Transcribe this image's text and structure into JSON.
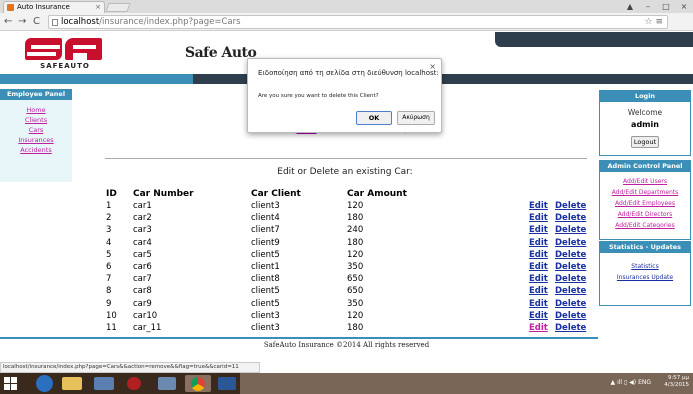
{
  "browser": {
    "tab_title": "Auto Insurance",
    "tab_close": "×",
    "url_host": "localhost",
    "url_path": "/insurance/index.php?page=Cars",
    "window_controls": [
      "▲",
      "–",
      "□",
      "×"
    ],
    "status_url": "localhost/insurance/index.php?page=Cars&&action=remove&&flag=true&&carid=11"
  },
  "header": {
    "logo_text": "SAFEAUTO",
    "site_title": "Safe Auto"
  },
  "left_panel": {
    "title": "Employee Panel",
    "links": [
      "Home",
      "Clients",
      "Cars",
      "Insurances",
      "Accidents"
    ]
  },
  "main": {
    "create_bracket_open": "[",
    "create_link": "ADD",
    "create_text": " - Create a new Car]",
    "edit_heading": "Edit or Delete an existing Car:",
    "columns": [
      "ID",
      "Car Number",
      "Car Client",
      "Car Amount"
    ],
    "edit_label": "Edit",
    "delete_label": "Delete",
    "rows": [
      {
        "id": "1",
        "number": "car1",
        "client": "client3",
        "amount": "120"
      },
      {
        "id": "2",
        "number": "car2",
        "client": "client4",
        "amount": "180"
      },
      {
        "id": "3",
        "number": "car3",
        "client": "client7",
        "amount": "240"
      },
      {
        "id": "4",
        "number": "car4",
        "client": "client9",
        "amount": "180"
      },
      {
        "id": "5",
        "number": "car5",
        "client": "client5",
        "amount": "120"
      },
      {
        "id": "6",
        "number": "car6",
        "client": "client1",
        "amount": "350"
      },
      {
        "id": "7",
        "number": "car7",
        "client": "client8",
        "amount": "650"
      },
      {
        "id": "8",
        "number": "car8",
        "client": "client5",
        "amount": "650"
      },
      {
        "id": "9",
        "number": "car9",
        "client": "client5",
        "amount": "350"
      },
      {
        "id": "10",
        "number": "car10",
        "client": "client3",
        "amount": "120"
      },
      {
        "id": "11",
        "number": "car_11",
        "client": "client3",
        "amount": "180"
      }
    ]
  },
  "footer": "SafeAuto Insurance ©2014 All rights reserved",
  "login_panel": {
    "title": "Login",
    "welcome": "Welcome",
    "user": "admin",
    "logout": "Logout"
  },
  "admin_panel": {
    "title": "Admin Control Panel",
    "links": [
      "Add/Edit Users",
      "Add/Edit Departments",
      "Add/Edit Employees",
      "Add/Edit Directors",
      "Add/Edit Categories"
    ]
  },
  "stats_panel": {
    "title": "Statistics - Updates",
    "links": [
      "Statistics",
      "Insurances Update"
    ]
  },
  "dialog": {
    "title": "Ειδοποίηση από τη σελίδα στη διεύθυνση localhost:",
    "close": "×",
    "message": "Are you sure you want to delete this Client?",
    "ok": "OK",
    "cancel": "Ακύρωση"
  },
  "taskbar": {
    "language": "ENG",
    "time": "9:57 μμ",
    "date": "4/3/2015"
  },
  "colors": {
    "accent_blue": "#3b8fb7",
    "dark_navy": "#2e3e4c",
    "logo_red": "#c8102e",
    "link_magenta": "#c020a0",
    "link_blue": "#1a2fa0"
  }
}
